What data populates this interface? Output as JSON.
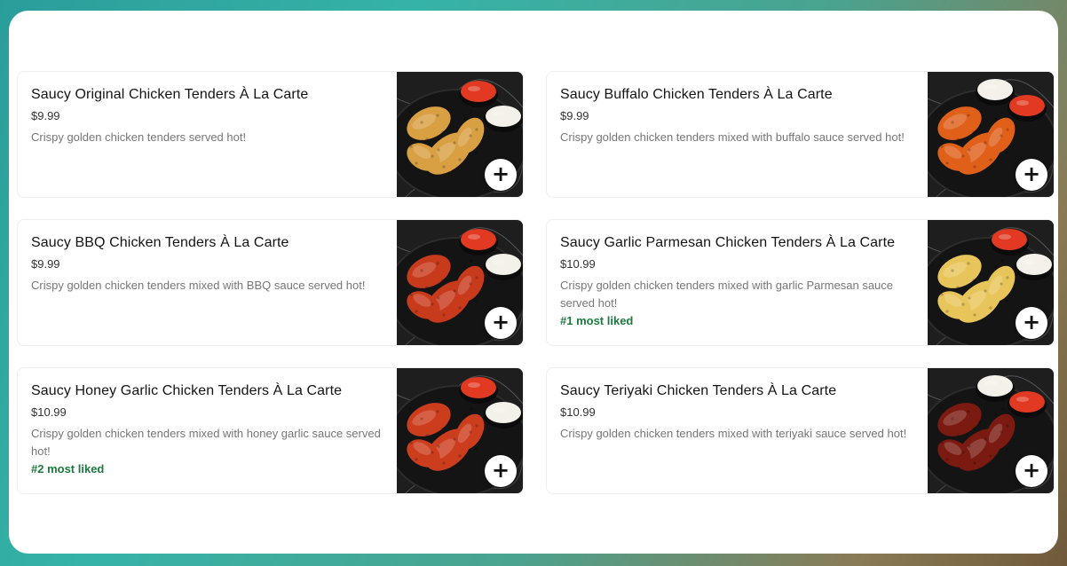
{
  "menu": {
    "items": [
      {
        "title": "Saucy Original Chicken Tenders À La Carte",
        "price": "$9.99",
        "description": "Crispy golden chicken tenders served hot!",
        "badge": "",
        "image_name": "original-tenders-image",
        "tender_color": "#d9a043",
        "add_icon": "plus-icon"
      },
      {
        "title": "Saucy Buffalo Chicken Tenders À La Carte",
        "price": "$9.99",
        "description": "Crispy golden chicken tenders mixed with buffalo sauce served hot!",
        "badge": "",
        "image_name": "buffalo-tenders-image",
        "tender_color": "#e0601a",
        "add_icon": "plus-icon"
      },
      {
        "title": "Saucy BBQ Chicken Tenders À La Carte",
        "price": "$9.99",
        "description": "Crispy golden chicken tenders mixed with BBQ sauce served hot!",
        "badge": "",
        "image_name": "bbq-tenders-image",
        "tender_color": "#c83a1c",
        "add_icon": "plus-icon"
      },
      {
        "title": "Saucy Garlic Parmesan Chicken Tenders À La Carte",
        "price": "$10.99",
        "description": "Crispy golden chicken tenders mixed with garlic Parmesan sauce served hot!",
        "badge": "#1 most liked",
        "image_name": "garlic-parmesan-tenders-image",
        "tender_color": "#e8c55a",
        "add_icon": "plus-icon"
      },
      {
        "title": "Saucy Honey Garlic Chicken Tenders À La Carte",
        "price": "$10.99",
        "description": "Crispy golden chicken tenders mixed with honey garlic sauce served hot!",
        "badge": "#2 most liked",
        "image_name": "honey-garlic-tenders-image",
        "tender_color": "#cc3d1e",
        "add_icon": "plus-icon"
      },
      {
        "title": "Saucy Teriyaki Chicken Tenders À La Carte",
        "price": "$10.99",
        "description": "Crispy golden chicken tenders mixed with teriyaki sauce served hot!",
        "badge": "",
        "image_name": "teriyaki-tenders-image",
        "tender_color": "#7a1a10",
        "add_icon": "plus-icon"
      }
    ]
  },
  "colors": {
    "badge_green": "#1d7a3e",
    "description_gray": "#767676",
    "red_sauce": "#e23a22",
    "ranch_sauce": "#f4f1ea",
    "plate_black": "#141414"
  }
}
